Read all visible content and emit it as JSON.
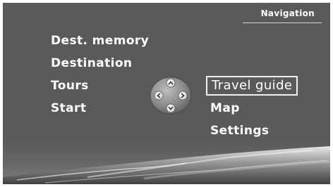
{
  "header": {
    "title": "Navigation"
  },
  "menu_left": {
    "items": [
      {
        "label": "Dest. memory"
      },
      {
        "label": "Destination"
      },
      {
        "label": "Tours"
      },
      {
        "label": "Start"
      }
    ]
  },
  "menu_right": {
    "items": [
      {
        "label": "Travel guide",
        "selected": true
      },
      {
        "label": "Map"
      },
      {
        "label": "Settings"
      }
    ]
  },
  "controller": {
    "icon": "four-way-controller-icon"
  },
  "colors": {
    "background": "#5a5a5a",
    "text": "#ffffff",
    "highlight_border": "#f0f0f0"
  }
}
